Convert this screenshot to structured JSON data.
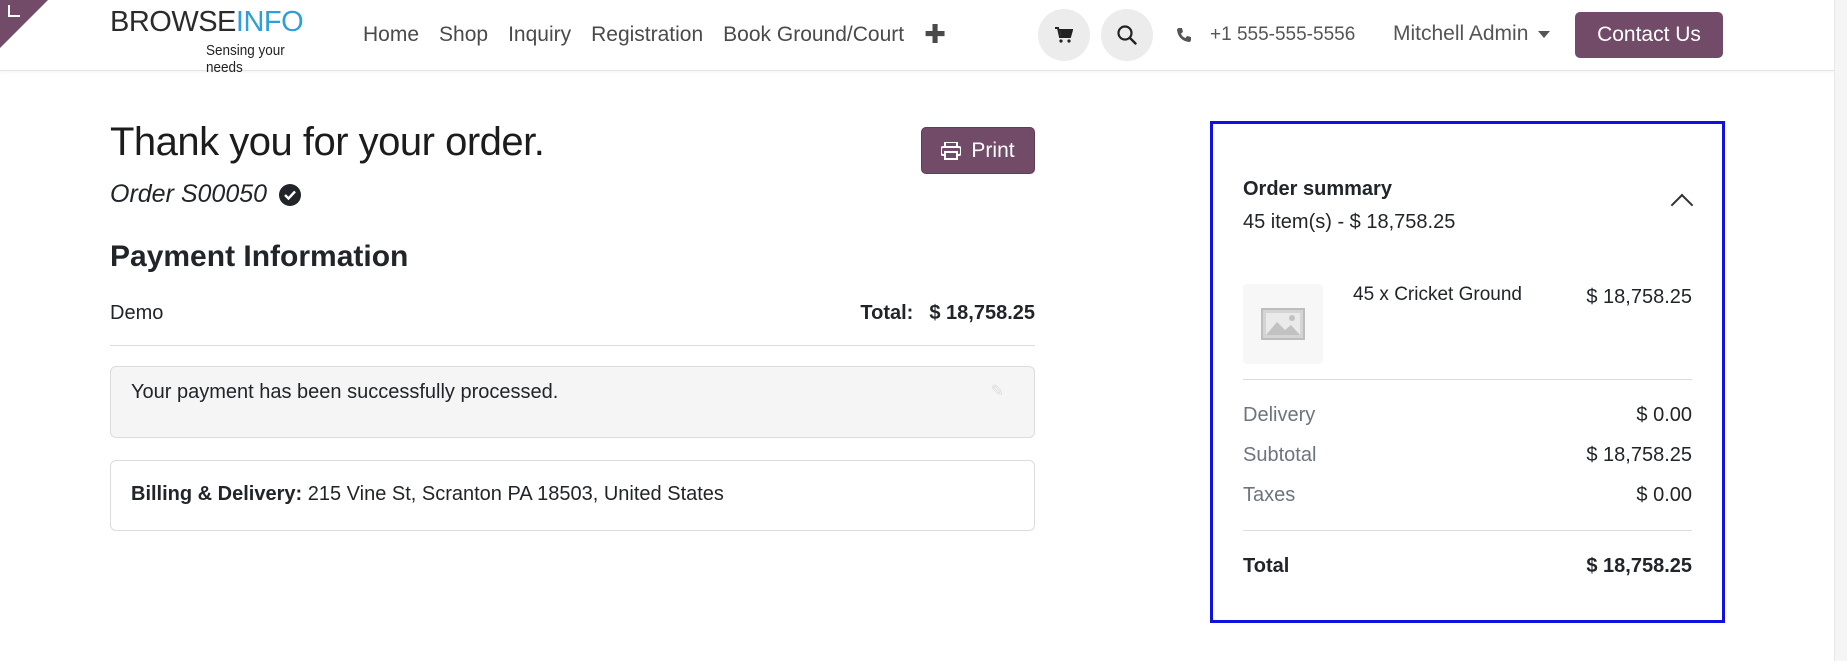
{
  "header": {
    "logo_part1": "BROWSE",
    "logo_part2": "INFO",
    "logo_tagline": "Sensing your needs",
    "nav": [
      "Home",
      "Shop",
      "Inquiry",
      "Registration",
      "Book Ground/Court"
    ],
    "phone": "+1 555-555-5556",
    "user": "Mitchell Admin",
    "contact_label": "Contact Us"
  },
  "main": {
    "title": "Thank you for your order.",
    "order_ref": "Order S00050",
    "print_label": "Print",
    "payment_heading": "Payment Information",
    "payment_method": "Demo",
    "total_label": "Total:",
    "total_value": "$ 18,758.25",
    "success_message": "Your payment has been successfully processed.",
    "billing_label": "Billing & Delivery:",
    "billing_address": "215 Vine St, Scranton PA 18503, United States"
  },
  "summary": {
    "title": "Order summary",
    "count_line": "45 item(s) -  $ 18,758.25",
    "item_name": "45 x Cricket Ground",
    "item_price": "$ 18,758.25",
    "delivery_label": "Delivery",
    "delivery_value": "$ 0.00",
    "subtotal_label": "Subtotal",
    "subtotal_value": "$ 18,758.25",
    "taxes_label": "Taxes",
    "taxes_value": "$ 0.00",
    "total_label": "Total",
    "total_value": "$ 18,758.25"
  },
  "colors": {
    "brand": "#714b67",
    "highlight": "#1010e0",
    "logo_blue": "#2f9fd8"
  }
}
